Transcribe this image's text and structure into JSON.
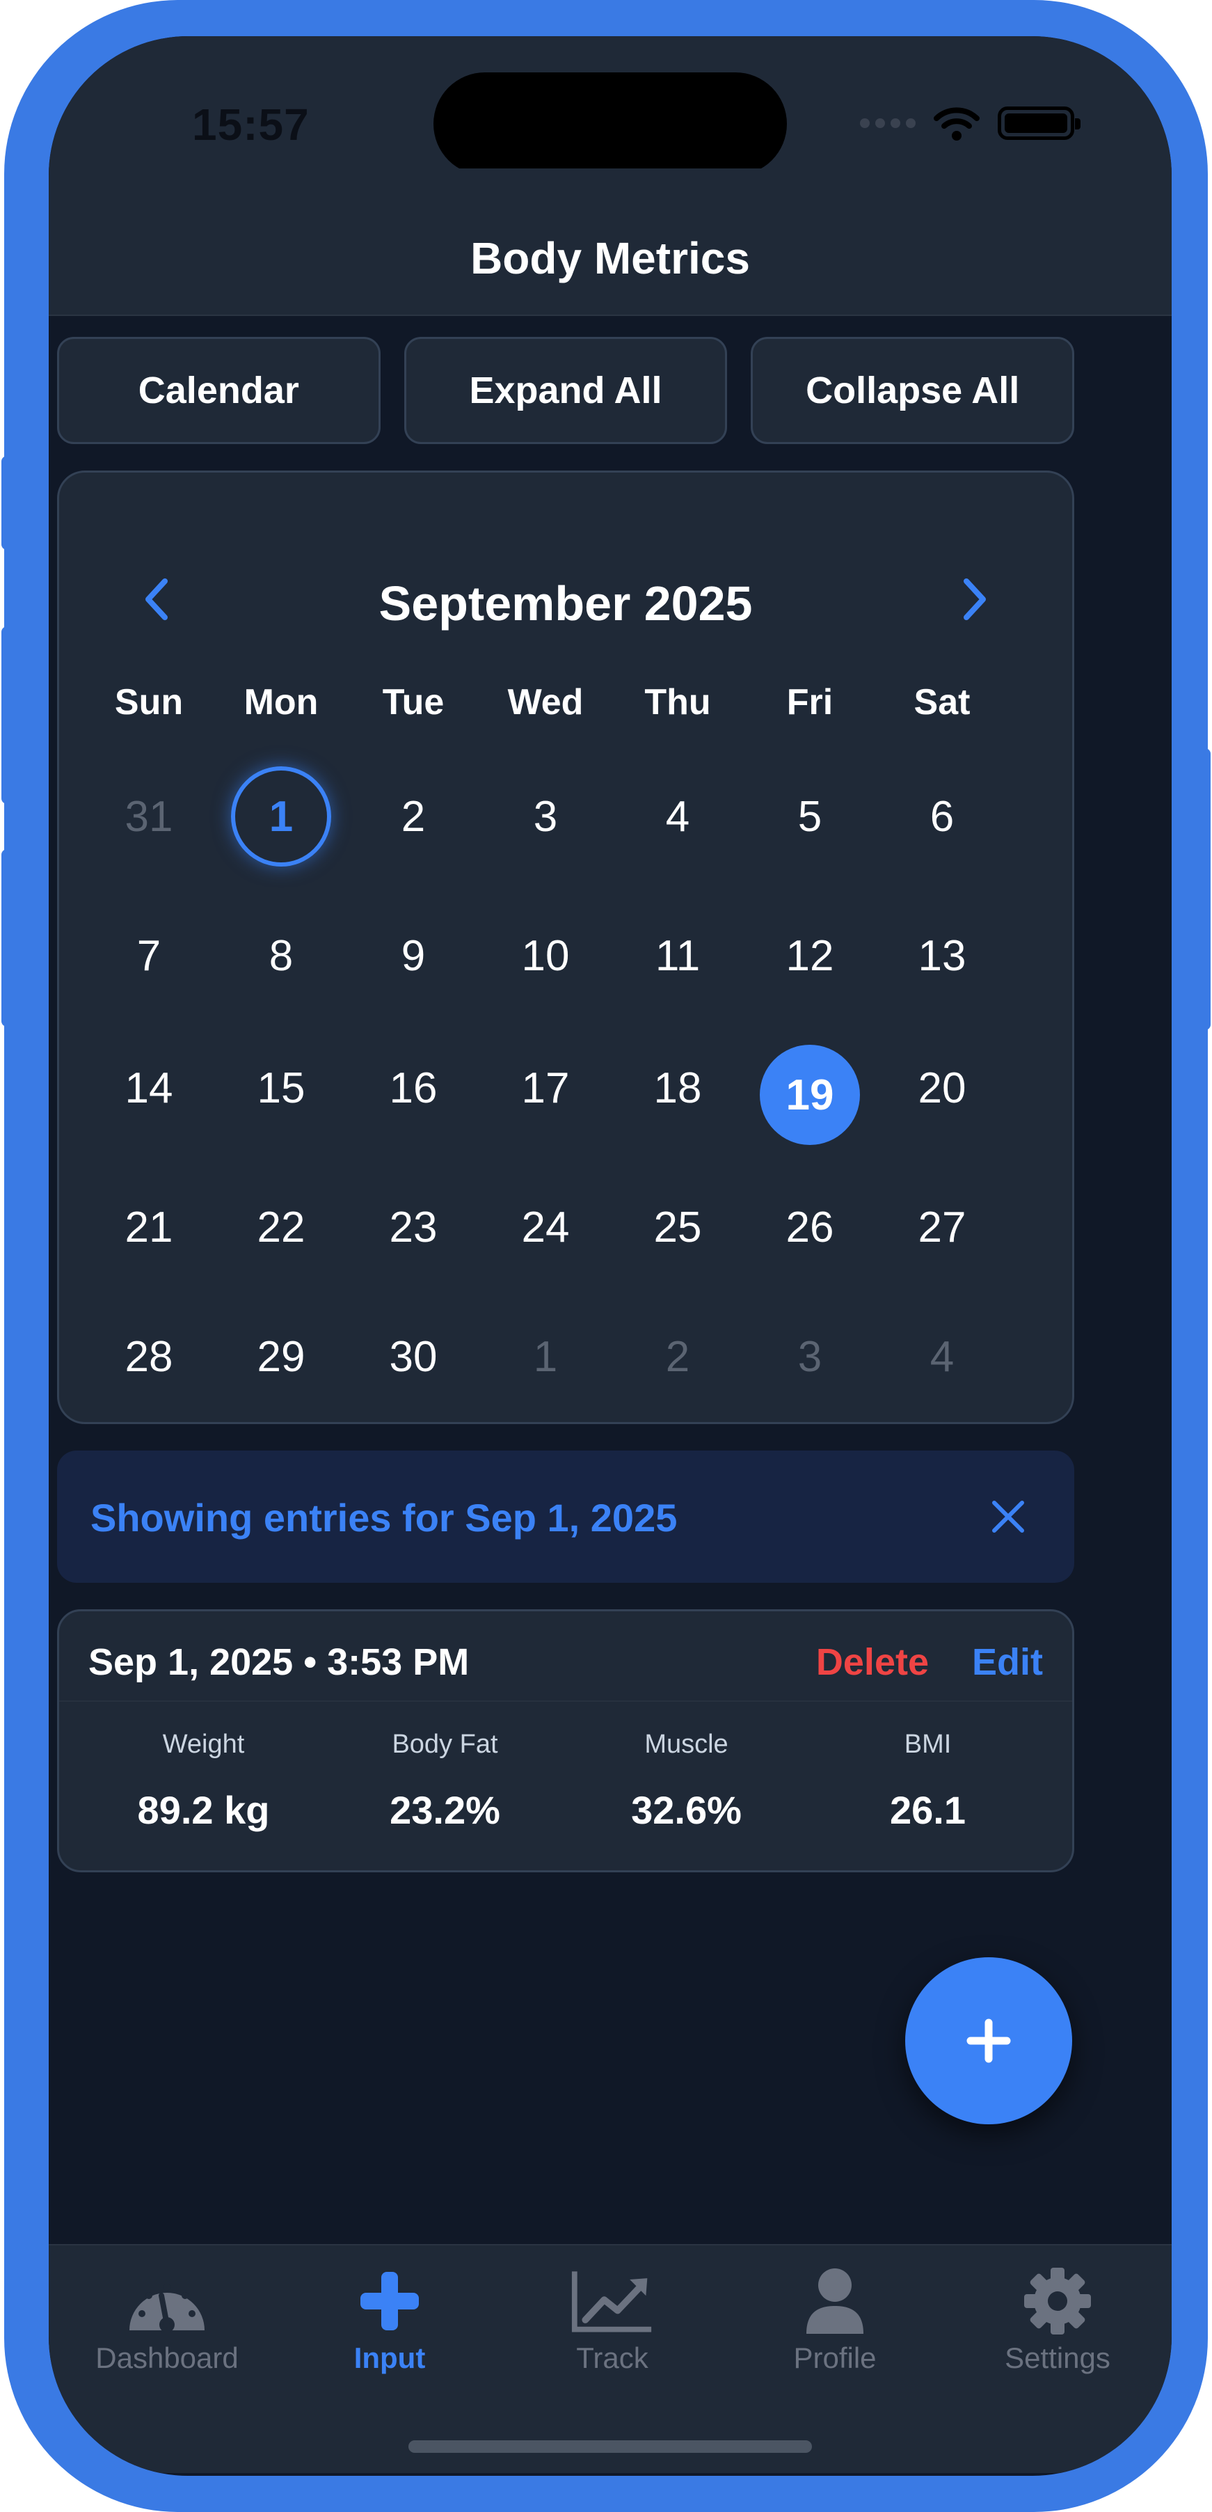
{
  "status_bar": {
    "time": "15:57"
  },
  "header": {
    "title": "Body Metrics"
  },
  "toolbar": {
    "calendar_label": "Calendar",
    "expand_label": "Expand All",
    "collapse_label": "Collapse All"
  },
  "calendar": {
    "month_label": "September 2025",
    "weekdays": [
      "Sun",
      "Mon",
      "Tue",
      "Wed",
      "Thu",
      "Fri",
      "Sat"
    ],
    "days": [
      "31",
      "1",
      "2",
      "3",
      "4",
      "5",
      "6",
      "7",
      "8",
      "9",
      "10",
      "11",
      "12",
      "13",
      "14",
      "15",
      "16",
      "17",
      "18",
      "19",
      "20",
      "21",
      "22",
      "23",
      "24",
      "25",
      "26",
      "27",
      "28",
      "29",
      "30",
      "1",
      "2",
      "3",
      "4"
    ],
    "today_label": "1",
    "selected_label": "19"
  },
  "filter": {
    "text": "Showing entries for Sep 1, 2025"
  },
  "entry": {
    "datetime": "Sep 1, 2025 • 3:53 PM",
    "delete_label": "Delete",
    "edit_label": "Edit",
    "metrics": [
      {
        "label": "Weight",
        "value": "89.2 kg"
      },
      {
        "label": "Body Fat",
        "value": "23.2%"
      },
      {
        "label": "Muscle",
        "value": "32.6%"
      },
      {
        "label": "BMI",
        "value": "26.1"
      }
    ]
  },
  "fab": {
    "icon": "plus-icon"
  },
  "tabs": [
    {
      "label": "Dashboard",
      "icon": "gauge-icon"
    },
    {
      "label": "Input",
      "icon": "plus-icon"
    },
    {
      "label": "Track",
      "icon": "chart-line-icon"
    },
    {
      "label": "Profile",
      "icon": "user-icon"
    },
    {
      "label": "Settings",
      "icon": "gear-icon"
    }
  ],
  "colors": {
    "accent": "#3b82f6",
    "danger": "#ef4444",
    "frame": "#3a7ae4",
    "background": "#101827",
    "surface": "#1f2937"
  }
}
